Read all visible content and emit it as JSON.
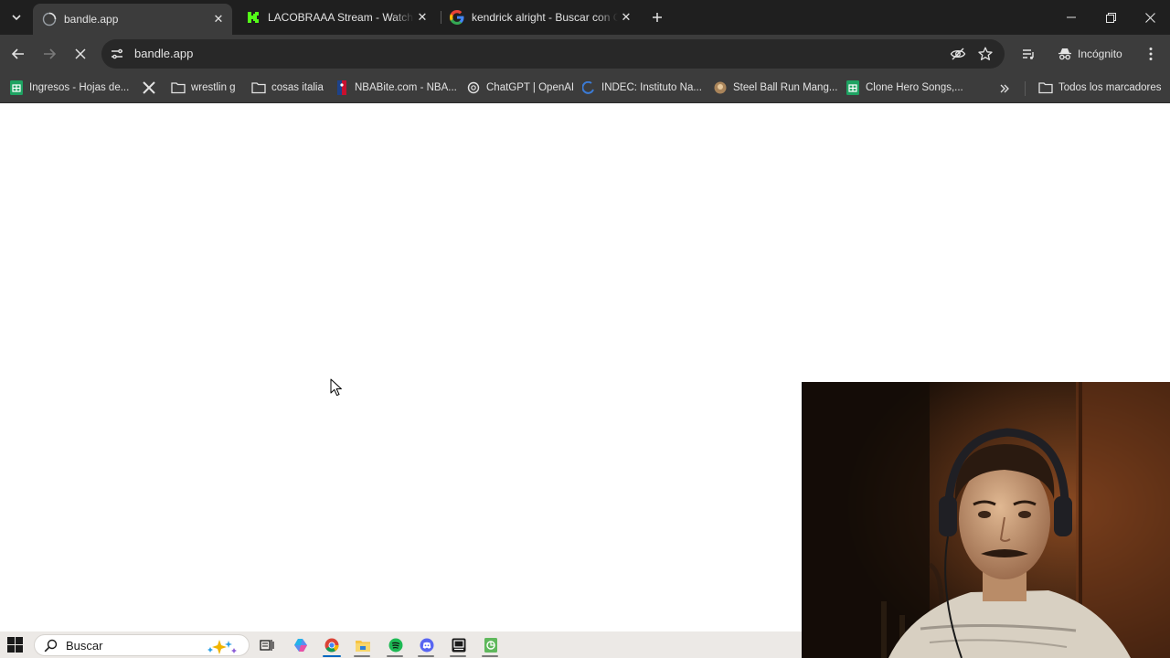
{
  "tabs": [
    {
      "title": "bandle.app",
      "active": true,
      "favicon": "loading-globe-icon"
    },
    {
      "title": "LACOBRAAA Stream - Watch Live",
      "active": false,
      "favicon": "kick-icon"
    },
    {
      "title": "kendrick alright - Buscar con Google",
      "active": false,
      "favicon": "google-icon"
    }
  ],
  "toolbar": {
    "url": "bandle.app",
    "incognito_label": "Incógnito"
  },
  "bookmarks": [
    {
      "label": "Ingresos - Hojas de...",
      "icon": "sheets-icon"
    },
    {
      "label": "",
      "icon": "x-icon"
    },
    {
      "label": "wrestlin g",
      "icon": "folder-icon"
    },
    {
      "label": "cosas italia",
      "icon": "folder-icon"
    },
    {
      "label": "NBABite.com - NBA...",
      "icon": "nba-icon"
    },
    {
      "label": "ChatGPT | OpenAI",
      "icon": "openai-icon"
    },
    {
      "label": "INDEC: Instituto Na...",
      "icon": "indec-icon"
    },
    {
      "label": "Steel Ball Run Mang...",
      "icon": "manga-icon"
    },
    {
      "label": "Clone Hero Songs,...",
      "icon": "sheets-icon"
    }
  ],
  "all_bookmarks_label": "Todos los marcadores",
  "taskbar": {
    "search_placeholder": "Buscar"
  },
  "colors": {
    "frame": "#1f1f1f",
    "toolbar": "#3c3c3c",
    "omnibox": "#282828",
    "taskbar": "#ece9e6",
    "accent": "#0067c0"
  }
}
